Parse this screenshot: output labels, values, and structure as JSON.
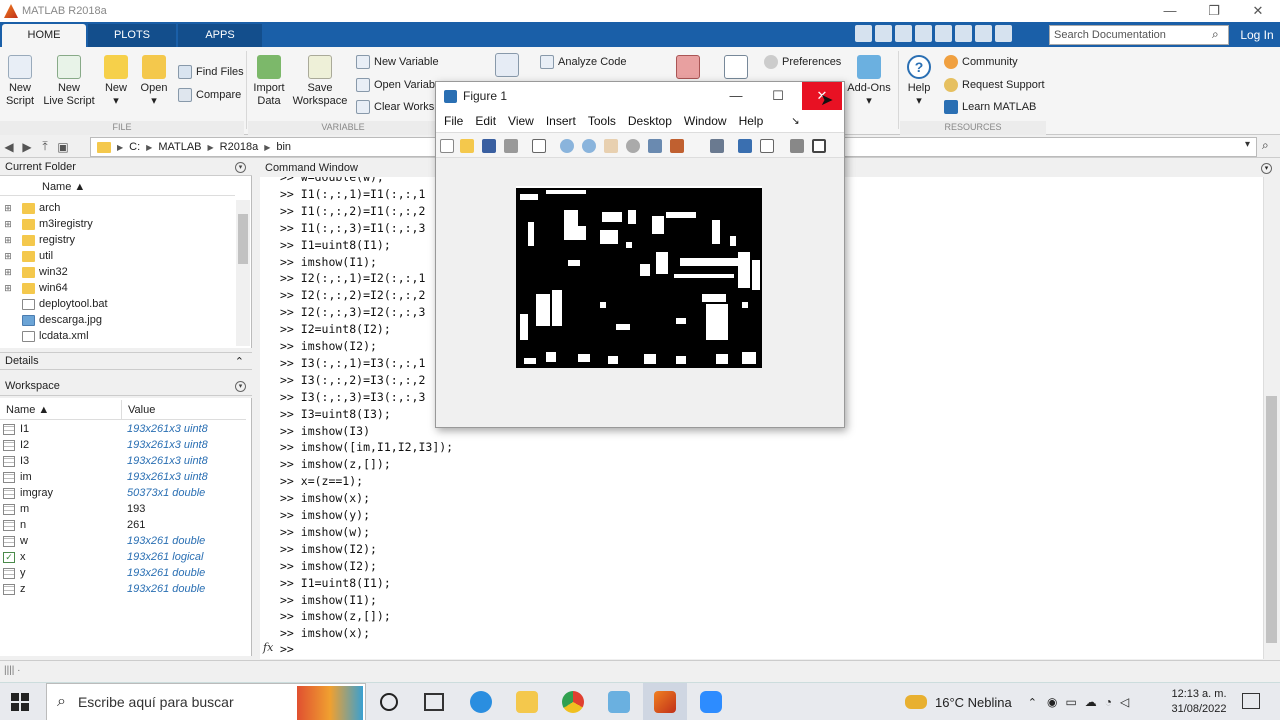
{
  "app": {
    "title": "MATLAB R2018a"
  },
  "window_controls": {
    "minimize": "—",
    "restore": "❐",
    "close": "✕"
  },
  "ribbon": {
    "tabs": [
      "HOME",
      "PLOTS",
      "APPS"
    ],
    "search_placeholder": "Search Documentation",
    "login": "Log In",
    "file_group": {
      "label": "FILE",
      "new_script": [
        "New",
        "Script"
      ],
      "new_live_script": [
        "New",
        "Live Script"
      ],
      "new": "New",
      "open": "Open",
      "find_files": "Find Files",
      "compare": "Compare"
    },
    "variable_group": {
      "label": "VARIABLE",
      "import_data": [
        "Import",
        "Data"
      ],
      "save_workspace": [
        "Save",
        "Workspace"
      ],
      "new_variable": "New Variable",
      "open_variable": "Open Variab",
      "clear_workspace": "Clear Worksp"
    },
    "code_group": {
      "analyze_code": "Analyze Code"
    },
    "env_group": {
      "preferences": "Preferences",
      "add_ons": "Add-Ons"
    },
    "resources_group": {
      "label": "RESOURCES",
      "help": "Help",
      "community": "Community",
      "request_support": "Request Support",
      "learn_matlab": "Learn MATLAB"
    }
  },
  "address": {
    "path": [
      "C:",
      "MATLAB",
      "R2018a",
      "bin"
    ],
    "sep": "▶"
  },
  "current_folder": {
    "title": "Current Folder",
    "col_name": "Name ▲",
    "items": [
      {
        "name": "arch",
        "kind": "folder",
        "expandable": true
      },
      {
        "name": "m3iregistry",
        "kind": "folder",
        "expandable": true
      },
      {
        "name": "registry",
        "kind": "folder",
        "expandable": true
      },
      {
        "name": "util",
        "kind": "folder",
        "expandable": true
      },
      {
        "name": "win32",
        "kind": "folder",
        "expandable": true
      },
      {
        "name": "win64",
        "kind": "folder",
        "expandable": true
      },
      {
        "name": "deploytool.bat",
        "kind": "file",
        "expandable": false
      },
      {
        "name": "descarga.jpg",
        "kind": "img",
        "expandable": false
      },
      {
        "name": "lcdata.xml",
        "kind": "file",
        "expandable": false
      }
    ]
  },
  "details": {
    "title": "Details"
  },
  "workspace": {
    "title": "Workspace",
    "col_name": "Name ▲",
    "col_value": "Value",
    "rows": [
      {
        "name": "I1",
        "value": "193x261x3 uint8",
        "plain": false,
        "icon": "matrix"
      },
      {
        "name": "I2",
        "value": "193x261x3 uint8",
        "plain": false,
        "icon": "matrix"
      },
      {
        "name": "I3",
        "value": "193x261x3 uint8",
        "plain": false,
        "icon": "matrix"
      },
      {
        "name": "im",
        "value": "193x261x3 uint8",
        "plain": false,
        "icon": "matrix"
      },
      {
        "name": "imgray",
        "value": "50373x1 double",
        "plain": false,
        "icon": "matrix"
      },
      {
        "name": "m",
        "value": "193",
        "plain": true,
        "icon": "matrix"
      },
      {
        "name": "n",
        "value": "261",
        "plain": true,
        "icon": "matrix"
      },
      {
        "name": "w",
        "value": "193x261 double",
        "plain": false,
        "icon": "matrix"
      },
      {
        "name": "x",
        "value": "193x261 logical",
        "plain": false,
        "icon": "check"
      },
      {
        "name": "y",
        "value": "193x261 double",
        "plain": false,
        "icon": "matrix"
      },
      {
        "name": "z",
        "value": "193x261 double",
        "plain": false,
        "icon": "matrix"
      }
    ]
  },
  "command_window": {
    "title": "Command Window",
    "lines": [
      ">> w=double(w);",
      ">> I1(:,:,1)=I1(:,:,1",
      ">> I1(:,:,2)=I1(:,:,2",
      ">> I1(:,:,3)=I1(:,:,3",
      ">> I1=uint8(I1);",
      ">> imshow(I1);",
      ">> I2(:,:,1)=I2(:,:,1",
      ">> I2(:,:,2)=I2(:,:,2",
      ">> I2(:,:,3)=I2(:,:,3",
      ">> I2=uint8(I2);",
      ">> imshow(I2);",
      ">> I3(:,:,1)=I3(:,:,1",
      ">> I3(:,:,2)=I3(:,:,2",
      ">> I3(:,:,3)=I3(:,:,3",
      ">> I3=uint8(I3);",
      ">> imshow(I3)",
      ">> imshow([im,I1,I2,I3]);",
      ">> imshow(z,[]);",
      ">> x=(z==1);",
      ">> imshow(x);",
      ">> imshow(y);",
      ">> imshow(w);",
      ">> imshow(I2);",
      ">> imshow(I2);",
      ">> I1=uint8(I1);",
      ">> imshow(I1);",
      ">> imshow(z,[]);",
      ">> imshow(x);"
    ],
    "prompt": ">>",
    "fx": "fx"
  },
  "figure": {
    "title": "Figure 1",
    "menu": [
      "File",
      "Edit",
      "View",
      "Insert",
      "Tools",
      "Desktop",
      "Window",
      "Help"
    ]
  },
  "taskbar": {
    "search_placeholder": "Escribe aquí para buscar",
    "weather": "16°C  Neblina",
    "time": "12:13 a. m.",
    "date": "31/08/2022"
  },
  "colors": {
    "ribbon_blue": "#1a5fa8",
    "close_red": "#e81123",
    "link_blue": "#2a6fb3"
  }
}
